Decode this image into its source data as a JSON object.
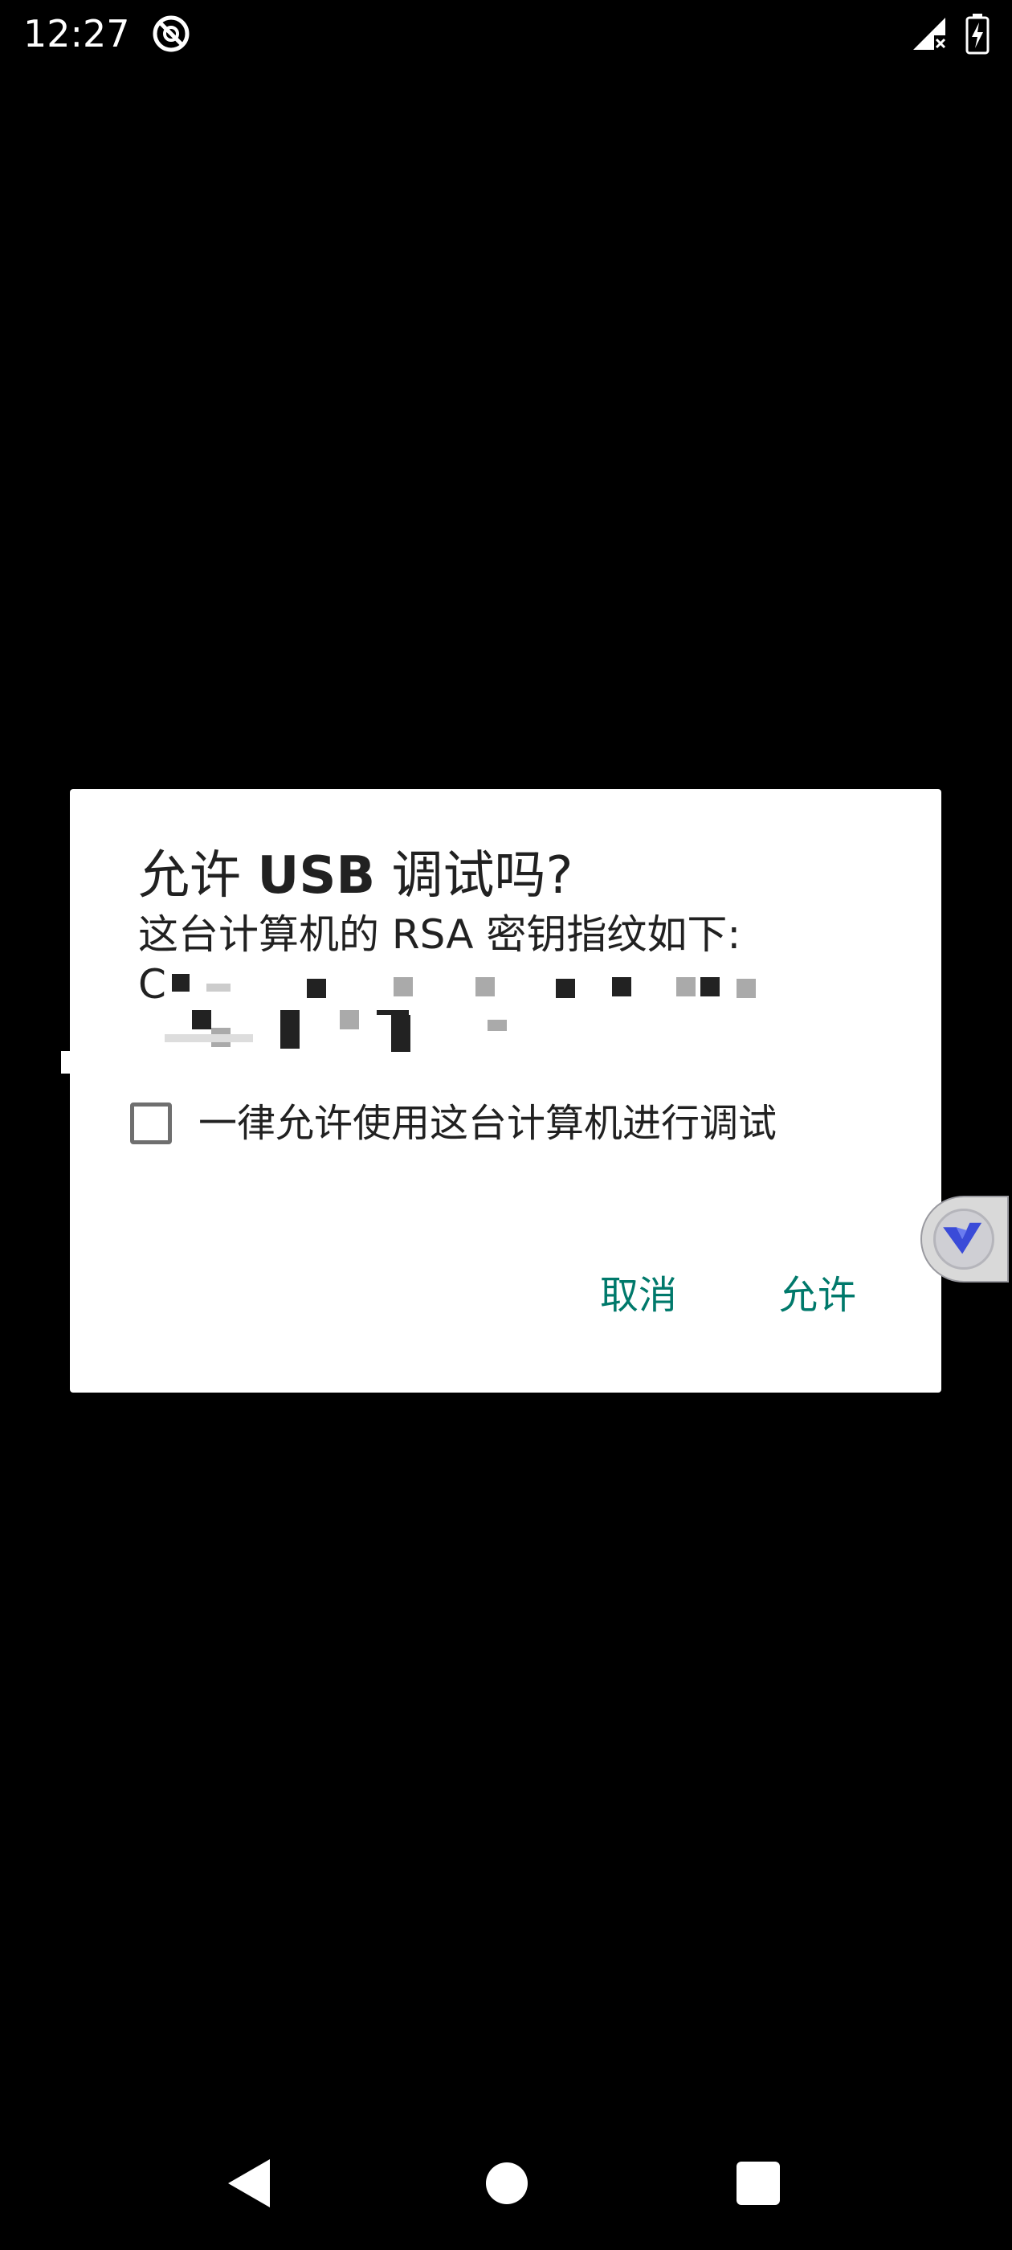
{
  "status_bar": {
    "time": "12:27",
    "icons": [
      "vpn-app-icon",
      "signal-no-sim-icon",
      "battery-charging-icon"
    ]
  },
  "dialog": {
    "title_prefix": "允许 ",
    "title_bold": "USB",
    "title_suffix": " 调试吗?",
    "message": "这台计算机的 RSA 密钥指纹如下:",
    "fingerprint_visible": "C",
    "checkbox": {
      "label": "一律允许使用这台计算机进行调试",
      "checked": false
    },
    "buttons": {
      "cancel": "取消",
      "allow": "允许"
    },
    "accent_color": "#00796b"
  },
  "floating_button": {
    "icon": "v-logo-icon"
  },
  "nav_bar": {
    "icons": [
      "back-icon",
      "home-icon",
      "recents-icon"
    ]
  }
}
